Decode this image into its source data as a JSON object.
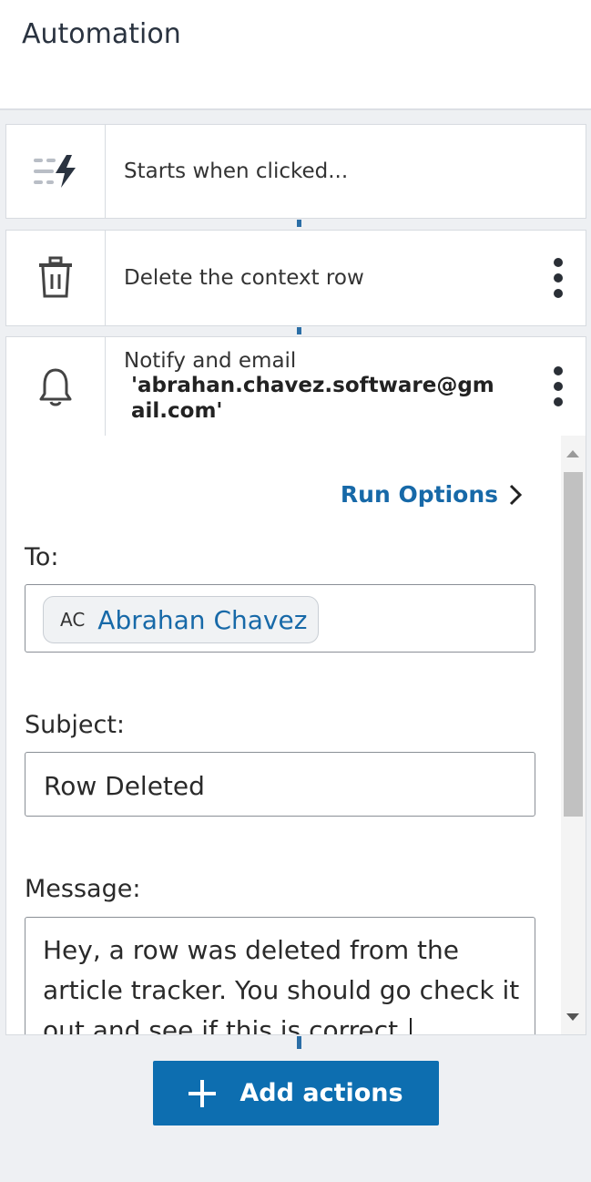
{
  "header": {
    "title": "Automation"
  },
  "steps": [
    {
      "label": "Starts when clicked...",
      "icon": "trigger-bolt-icon"
    },
    {
      "label": "Delete the context row",
      "icon": "trash-icon"
    },
    {
      "label": "Notify and email",
      "email": "'abrahan.chavez.software@gm ail.com'",
      "icon": "bell-icon"
    }
  ],
  "panel": {
    "run_options": "Run Options",
    "to_label": "To:",
    "recipient": {
      "initials": "AC",
      "name": "Abrahan Chavez"
    },
    "subject_label": "Subject:",
    "subject_value": "Row Deleted",
    "message_label": "Message:",
    "message_value": "Hey, a row was deleted from the article tracker. You should go check it out and see if this is correct."
  },
  "footer": {
    "add_actions": "Add actions"
  },
  "colors": {
    "accent": "#0d6eb0",
    "link": "#1769a8"
  }
}
